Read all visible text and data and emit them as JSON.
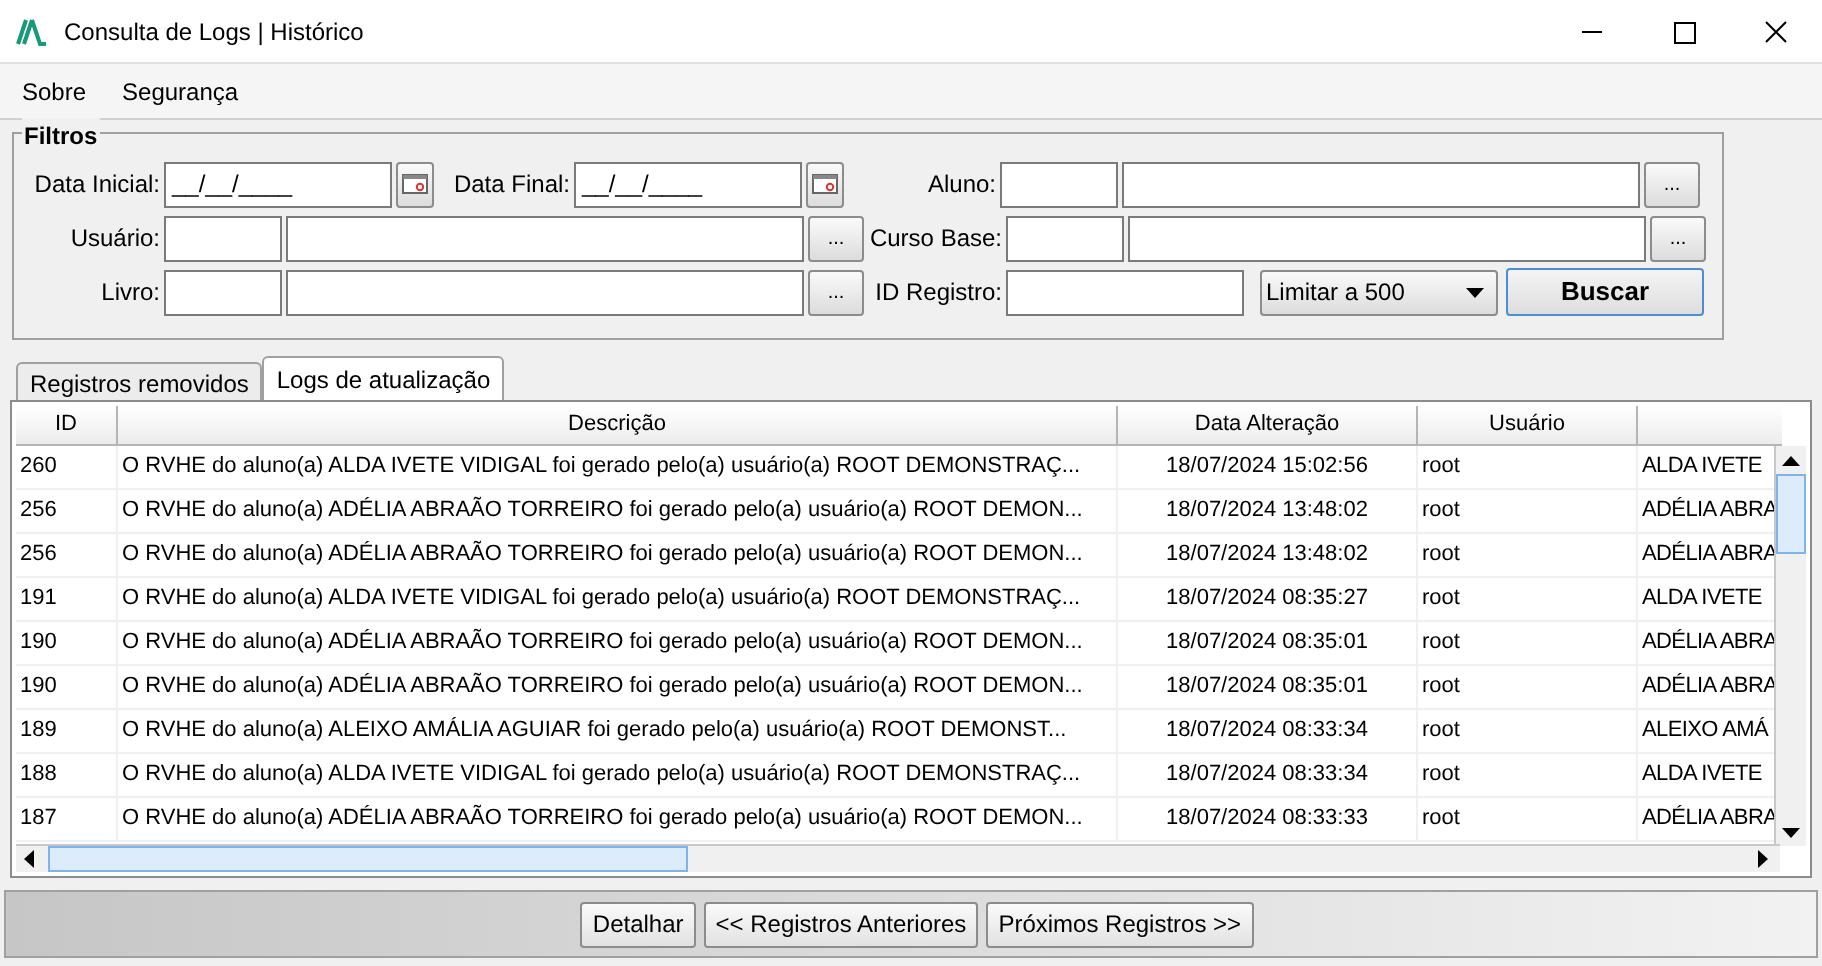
{
  "window": {
    "title": "Consulta de Logs | Histórico"
  },
  "menu": [
    {
      "label": "Sobre"
    },
    {
      "label": "Segurança"
    }
  ],
  "filters": {
    "title": "Filtros",
    "fields": [
      {
        "kind": "date",
        "label": "Data Inicial:",
        "value": "__/__/____"
      },
      {
        "kind": "date",
        "label": "Data Final:",
        "value": "__/__/____"
      },
      {
        "kind": "lookup",
        "label": "Aluno:",
        "button": "..."
      },
      {
        "kind": "lookup",
        "label": "Usuário:",
        "button": "..."
      },
      {
        "kind": "lookup",
        "label": "Curso Base:",
        "button": "..."
      },
      {
        "kind": "lookup",
        "label": "Livro:",
        "button": "..."
      },
      {
        "kind": "text",
        "label": "ID Registro:"
      },
      {
        "kind": "select",
        "value": "Limitar a 500"
      },
      {
        "kind": "button",
        "label": "Buscar"
      }
    ]
  },
  "tabs": [
    {
      "label": "Registros removidos",
      "selected": false
    },
    {
      "label": "Logs de atualização",
      "selected": true
    }
  ],
  "table": {
    "columns": [
      "ID",
      "Descrição",
      "Data Alteração",
      "Usuário"
    ],
    "rows": [
      {
        "id": "260",
        "descricao": "O RVHE do aluno(a) ALDA IVETE VIDIGAL foi gerado pelo(a) usuário(a) ROOT DEMONSTRAÇ...",
        "data": "18/07/2024 15:02:56",
        "usuario": "root",
        "column_5": "ALDA IVETE"
      },
      {
        "id": "256",
        "descricao": "O RVHE do aluno(a) ADÉLIA ABRAÃO TORREIRO foi gerado pelo(a) usuário(a) ROOT DEMON...",
        "data": "18/07/2024 13:48:02",
        "usuario": "root",
        "column_5": "ADÉLIA ABRA"
      },
      {
        "id": "256",
        "descricao": "O RVHE do aluno(a) ADÉLIA ABRAÃO TORREIRO foi gerado pelo(a) usuário(a) ROOT DEMON...",
        "data": "18/07/2024 13:48:02",
        "usuario": "root",
        "column_5": "ADÉLIA ABRA"
      },
      {
        "id": "191",
        "descricao": "O RVHE do aluno(a) ALDA IVETE VIDIGAL foi gerado pelo(a) usuário(a) ROOT DEMONSTRAÇ...",
        "data": "18/07/2024 08:35:27",
        "usuario": "root",
        "column_5": "ALDA IVETE"
      },
      {
        "id": "190",
        "descricao": "O RVHE do aluno(a) ADÉLIA ABRAÃO TORREIRO foi gerado pelo(a) usuário(a) ROOT DEMON...",
        "data": "18/07/2024 08:35:01",
        "usuario": "root",
        "column_5": "ADÉLIA ABRA"
      },
      {
        "id": "190",
        "descricao": "O RVHE do aluno(a) ADÉLIA ABRAÃO TORREIRO foi gerado pelo(a) usuário(a) ROOT DEMON...",
        "data": "18/07/2024 08:35:01",
        "usuario": "root",
        "column_5": "ADÉLIA ABRA"
      },
      {
        "id": "189",
        "descricao": "O RVHE do aluno(a) ALEIXO AMÁLIA AGUIAR foi gerado pelo(a) usuário(a) ROOT DEMONST...",
        "data": "18/07/2024 08:33:34",
        "usuario": "root",
        "column_5": "ALEIXO AMÁ"
      },
      {
        "id": "188",
        "descricao": "O RVHE do aluno(a) ALDA IVETE VIDIGAL foi gerado pelo(a) usuário(a) ROOT DEMONSTRAÇ...",
        "data": "18/07/2024 08:33:34",
        "usuario": "root",
        "column_5": "ALDA IVETE"
      },
      {
        "id": "187",
        "descricao": "O RVHE do aluno(a) ADÉLIA ABRAÃO TORREIRO foi gerado pelo(a) usuário(a) ROOT DEMON...",
        "data": "18/07/2024 08:33:33",
        "usuario": "root",
        "column_5": "ADÉLIA ABRA"
      }
    ]
  },
  "actions": [
    {
      "label": "Detalhar"
    },
    {
      "label": "<< Registros Anteriores"
    },
    {
      "label": "Próximos Registros >>"
    }
  ]
}
